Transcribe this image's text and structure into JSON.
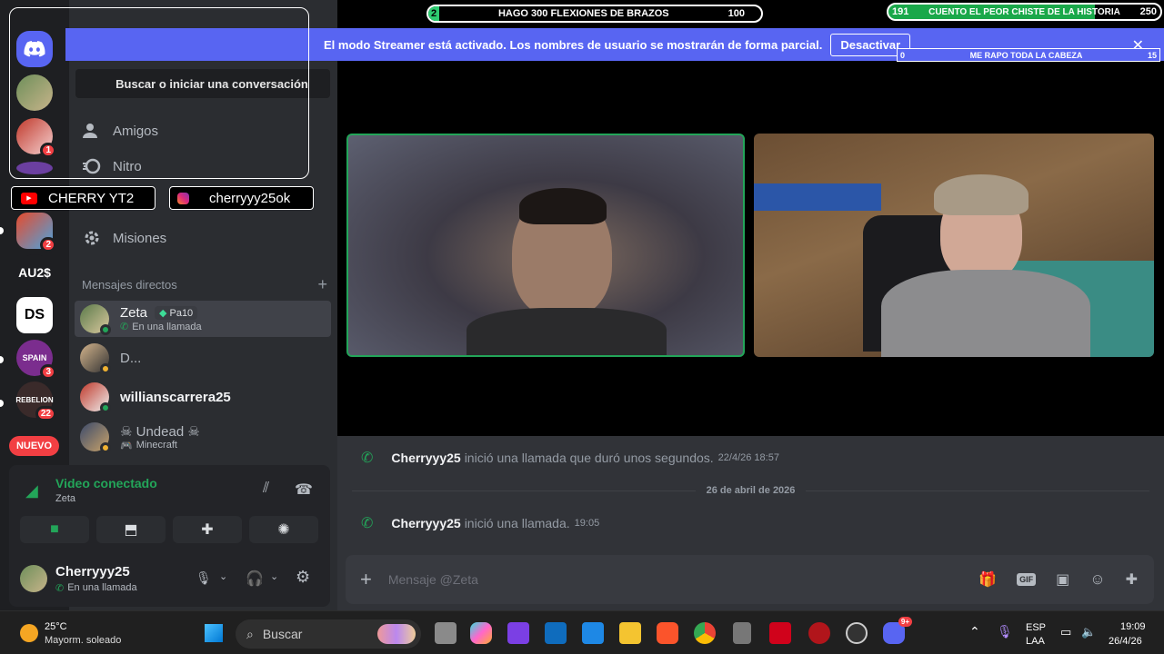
{
  "banner": {
    "message": "El modo Streamer está activado. Los nombres de usuario se mostrarán de forma parcial.",
    "button_label": "Desactivar"
  },
  "overlays": {
    "goal_center": {
      "current": "2",
      "label": "HAGO 300 FLEXIONES DE BRAZOS",
      "target": "100"
    },
    "goal_right": {
      "current": "191",
      "label": "CUENTO EL PEOR CHISTE DE LA HISTORIA",
      "target": "250"
    },
    "goal_banner": {
      "current": "0",
      "label": "ME RAPO TODA LA CABEZA",
      "target": "15"
    },
    "youtube_label": "CHERRY YT2",
    "instagram_label": "cherryyy25ok"
  },
  "servers": [
    {
      "name": "discord-home"
    },
    {
      "name": "avatar-1"
    },
    {
      "name": "avatar-2",
      "badge": "1"
    },
    {
      "name": "server-3"
    },
    {
      "name": "server-mario",
      "badge": "2"
    },
    {
      "name": "server-au2",
      "label": "AU2$"
    },
    {
      "name": "server-ds",
      "label": "DS"
    },
    {
      "name": "server-spain",
      "label": "SPAIN",
      "badge": "3"
    },
    {
      "name": "server-rebelion",
      "label": "REBELION",
      "badge": "22"
    },
    {
      "name": "nuevo",
      "label": "NUEVO"
    }
  ],
  "panel": {
    "search_placeholder": "Buscar o iniciar una conversación",
    "nav": [
      {
        "label": "Amigos",
        "icon": "friends-icon"
      },
      {
        "label": "Nitro",
        "icon": "nitro-icon"
      },
      {
        "label": "Misiones",
        "icon": "quests-icon"
      }
    ],
    "dm_header": "Mensajes directos",
    "dms": [
      {
        "name": "Zeta",
        "tag": "Pa10",
        "sub": "En una llamada",
        "active": true
      },
      {
        "name": "D...",
        "sub": ""
      },
      {
        "name": "willianscarrera25",
        "sub": ""
      },
      {
        "name": "☠ Undead ☠",
        "sub": "Minecraft"
      }
    ]
  },
  "voice": {
    "status": "Video conectado",
    "channel": "Zeta"
  },
  "user": {
    "name": "Cherryyy25",
    "status": "En una llamada"
  },
  "chat": {
    "messages": [
      {
        "author": "Cherryyy25",
        "text": "inició una llamada que duró unos segundos.",
        "time": "22/4/26 18:57"
      },
      {
        "author": "Cherryyy25",
        "text": "inició una llamada.",
        "time": "19:05"
      }
    ],
    "date_divider": "26 de abril de 2026",
    "composer_placeholder": "Mensaje @Zeta"
  },
  "taskbar": {
    "weather_temp": "25°C",
    "weather_desc": "Mayorm. soleado",
    "search_label": "Buscar",
    "lang_line1": "ESP",
    "lang_line2": "LAA",
    "time": "19:09",
    "date": "26/4/26",
    "discord_badge": "9+"
  },
  "colors": {
    "blurple": "#5865f2",
    "green": "#23a559",
    "red": "#f23f43"
  }
}
